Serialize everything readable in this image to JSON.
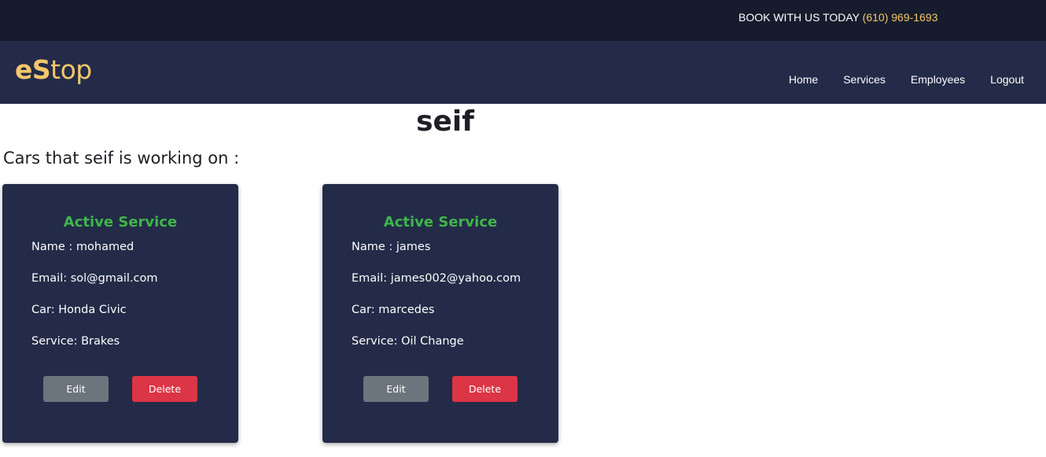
{
  "topbar": {
    "book_text": "BOOK WITH US TODAY",
    "phone": "(610) 969-1693"
  },
  "header": {
    "logo_bold": "eS",
    "logo_light": "top",
    "nav": [
      "Home",
      "Services",
      "Employees",
      "Logout"
    ]
  },
  "main": {
    "title": "seif",
    "subtitle": "Cars that seif is working on :",
    "cards": [
      {
        "heading": "Active Service",
        "name": "Name : mohamed",
        "email": "Email: sol@gmail.com",
        "car": "Car: Honda Civic",
        "service": "Service: Brakes",
        "edit_label": "Edit",
        "delete_label": "Delete"
      },
      {
        "heading": "Active Service",
        "name": "Name : james",
        "email": "Email: james002@yahoo.com",
        "car": "Car: marcedes",
        "service": "Service: Oil Change",
        "edit_label": "Edit",
        "delete_label": "Delete"
      }
    ]
  },
  "colors": {
    "topbar_bg": "#161c2d",
    "navbar_bg": "#232b48",
    "accent_gold": "#f5c76b",
    "active_green": "#3fb549",
    "edit_gray": "#6c757d",
    "delete_red": "#dc3545"
  }
}
